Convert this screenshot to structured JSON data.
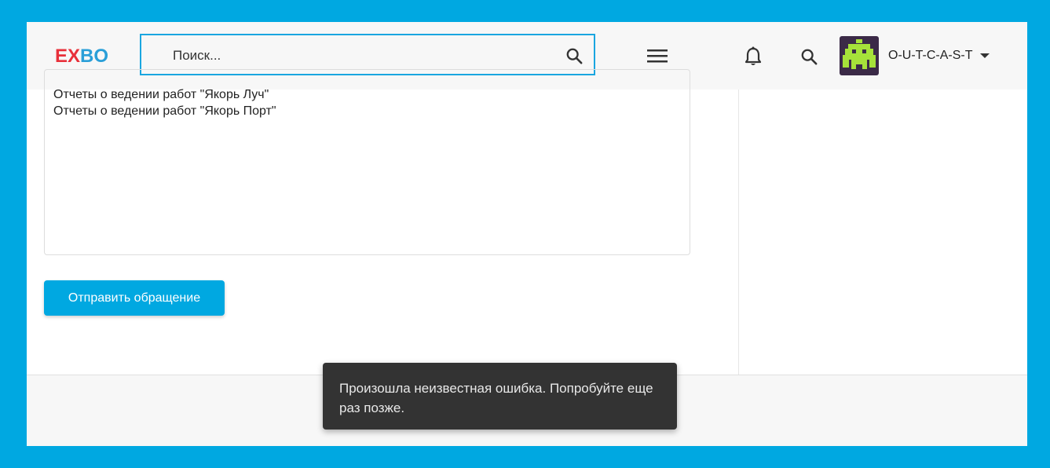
{
  "header": {
    "logo": {
      "e": "E",
      "x": "X",
      "bo": "BO"
    },
    "search_placeholder": "Поиск...",
    "username": "O-U-T-C-A-S-T"
  },
  "content": {
    "report_lines": [
      "Отчеты о ведении работ \"Якорь Луч\"",
      "Отчеты о ведении работ \"Якорь Порт\""
    ],
    "submit_label": "Отправить обращение"
  },
  "toast": {
    "message": "Произошла неизвестная ошибка. Попробуйте еще раз позже."
  },
  "colors": {
    "accent": "#00a8e1",
    "logo_red": "#e8303a",
    "logo_blue": "#2a9fd8",
    "avatar_bg": "#3b2a47",
    "avatar_fg": "#a6e23a",
    "toast_bg": "#333333"
  },
  "icons": [
    "search-icon",
    "menu-icon",
    "bell-icon",
    "caret-down-icon",
    "avatar-invader-icon"
  ]
}
